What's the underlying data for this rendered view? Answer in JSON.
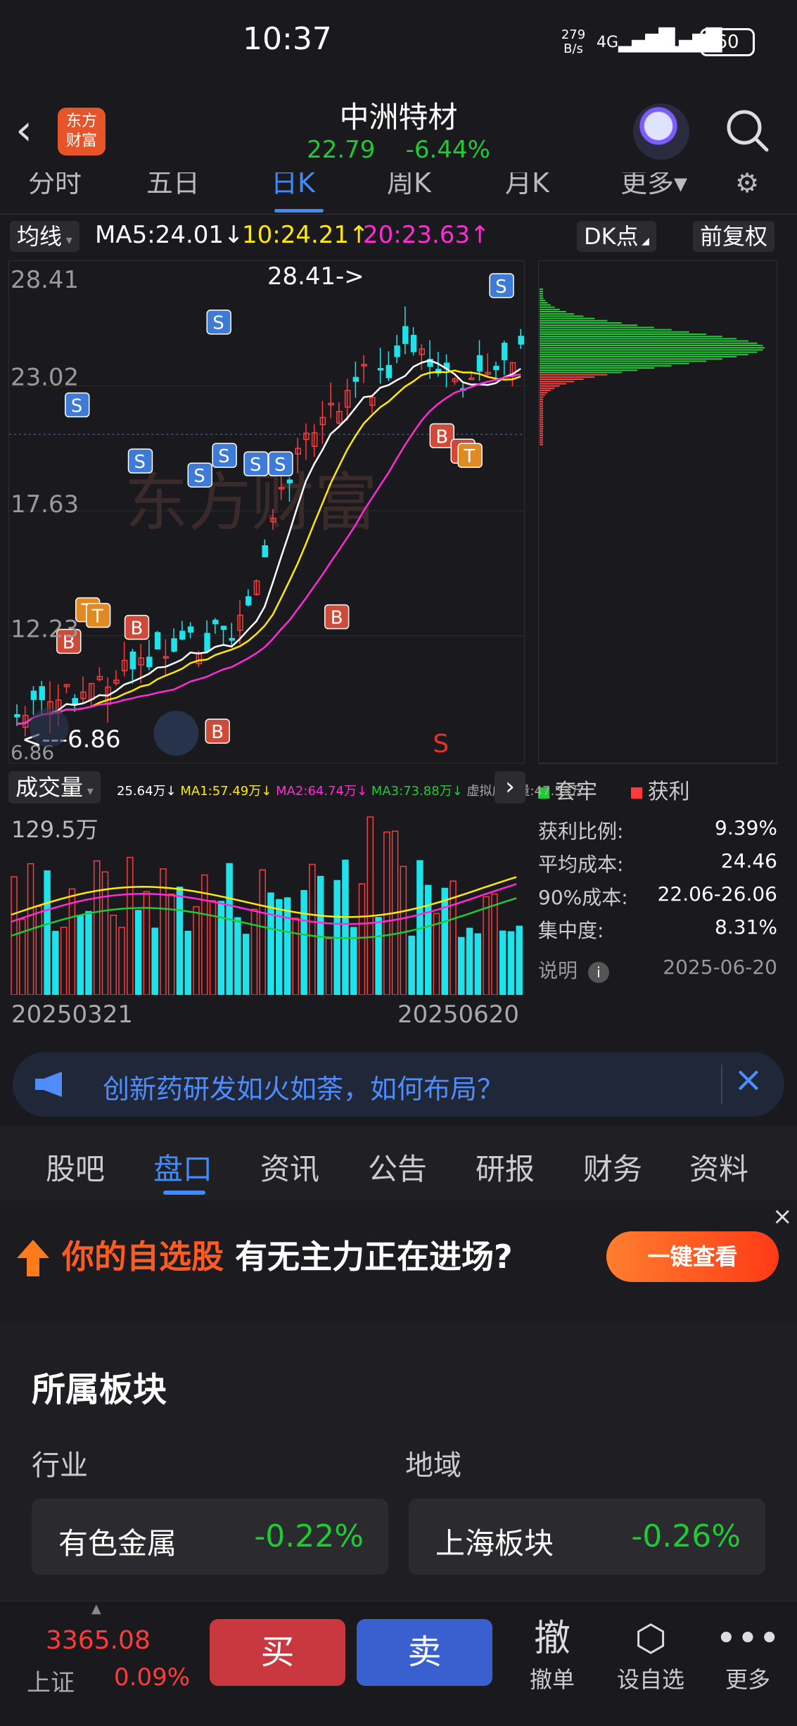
{
  "status_bar": {
    "time": "10:37",
    "net_speed_value": "279",
    "net_speed_unit": "B/s",
    "signal1": "4G",
    "signal2": "5G",
    "battery": "60"
  },
  "header": {
    "logo_text": "东方财富",
    "stock_name": "中洲特材",
    "price": "22.79",
    "change_pct": "-6.44%"
  },
  "period_tabs": [
    "分时",
    "五日",
    "日K",
    "周K",
    "月K",
    "更多▾"
  ],
  "ma_bar": {
    "selector": "均线",
    "ma5": "MA5:24.01↓",
    "ma10": "10:24.21↑",
    "ma20": "20:23.63↑",
    "dk_button": "DK点",
    "adjust_button": "前复权"
  },
  "kline": {
    "y_labels": [
      "28.41",
      "23.02",
      "17.63",
      "12.23",
      "6.86"
    ],
    "high_annotation": "28.41->",
    "low_annotation": "<---6.86",
    "watermark": "东方财富",
    "signal_s": "S",
    "markers": [
      "S",
      "S",
      "S",
      "S",
      "S",
      "S",
      "S",
      "S",
      "B",
      "B",
      "B",
      "B",
      "B",
      "B",
      "T",
      "T",
      "T"
    ]
  },
  "volume": {
    "title": "成交量",
    "indicators": [
      "25.64万↓",
      "MA1:57.49万↓",
      "MA2:64.74万↓",
      "MA3:73.88万↓",
      "虚拟成交量:47.53万"
    ],
    "max_label": "129.5万",
    "date_start": "20250321",
    "date_end": "20250620"
  },
  "chip": {
    "legend_trapped": "套牢",
    "legend_profit": "获利",
    "stats": [
      {
        "label": "获利比例:",
        "value": "9.39%"
      },
      {
        "label": "平均成本:",
        "value": "24.46"
      },
      {
        "label": "90%成本:",
        "value": "22.06-26.06"
      },
      {
        "label": "集中度:",
        "value": "8.31%"
      }
    ],
    "note_label": "说明",
    "date": "2025-06-20"
  },
  "news_banner": {
    "text": "创新药研发如火如荼，如何布局？"
  },
  "content_tabs": [
    "股吧",
    "盘口",
    "资讯",
    "公告",
    "研报",
    "财务",
    "资料"
  ],
  "ad": {
    "highlight": "你的自选股",
    "text": "有无主力正在进场?",
    "button": "一键查看"
  },
  "sector": {
    "title": "所属板块",
    "industry_label": "行业",
    "region_label": "地域",
    "industry_name": "有色金属",
    "industry_pct": "-0.22%",
    "region_name": "上海板块",
    "region_pct": "-0.26%"
  },
  "bottom_bar": {
    "index_value": "3365.08",
    "index_name": "上证",
    "index_pct": "0.09%",
    "buy": "买",
    "sell": "卖",
    "cancel_icon": "撤",
    "cancel_label": "撤单",
    "watch_label": "设自选",
    "more_label": "更多"
  },
  "colors": {
    "up": "#ff3b3b",
    "down": "#1ecb35",
    "accent": "#3d8bff",
    "ma5": "#ffffff",
    "ma10": "#ffea00",
    "ma20": "#ff2bd6"
  }
}
